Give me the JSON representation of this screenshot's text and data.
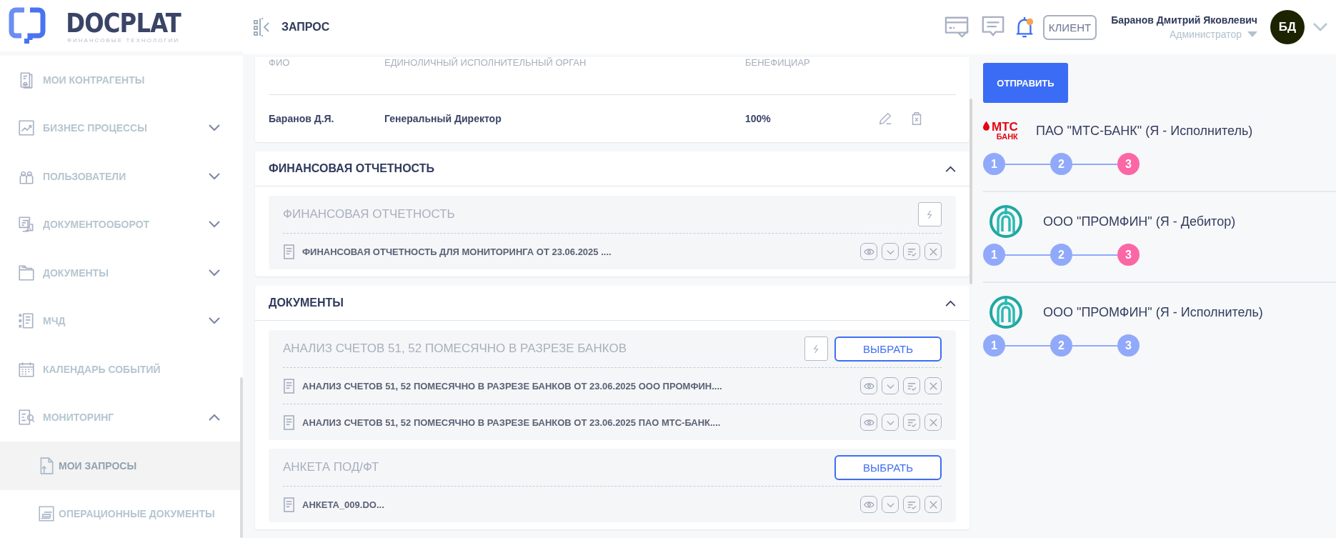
{
  "logo": {
    "name": "DOCPLAT",
    "tagline": "ФИНАНСОВЫЕ ТЕХНОЛОГИИ"
  },
  "sidebar": {
    "items": [
      {
        "label": "МОИ КОНТРАГЕНТЫ",
        "kind": "link",
        "selected": false
      },
      {
        "label": "БИЗНЕС ПРОЦЕССЫ",
        "kind": "group",
        "expanded": false,
        "selected": false
      },
      {
        "label": "ПОЛЬЗОВАТЕЛИ",
        "kind": "group",
        "expanded": false,
        "selected": false
      },
      {
        "label": "ДОКУМЕНТООБОРОТ",
        "kind": "group",
        "expanded": false,
        "selected": false
      },
      {
        "label": "ДОКУМЕНТЫ",
        "kind": "group",
        "expanded": false,
        "selected": false
      },
      {
        "label": "МЧД",
        "kind": "group",
        "expanded": false,
        "selected": false
      },
      {
        "label": "КАЛЕНДАРЬ СОБЫТИЙ",
        "kind": "link",
        "selected": false
      },
      {
        "label": "МОНИТОРИНГ",
        "kind": "group",
        "expanded": true,
        "selected": false,
        "children": [
          {
            "label": "МОИ ЗАПРОСЫ",
            "selected": true
          },
          {
            "label": "ОПЕРАЦИОННЫЕ ДОКУМЕНТЫ",
            "selected": false
          }
        ]
      }
    ]
  },
  "header": {
    "title": "ЗАПРОС",
    "notifications_unread": true,
    "role_button": "КЛИЕНТ",
    "user_name": "Баранов Дмитрий Яковлевич",
    "user_role": "Администратор",
    "avatar_initials": "БД"
  },
  "table": {
    "columns": [
      "ФИО",
      "ЕДИНОЛИЧНЫЙ ИСПОЛНИТЕЛЬНЫЙ ОРГАН",
      "БЕНЕФИЦИАР"
    ],
    "rows": [
      [
        "Баранов Д.Я.",
        "Генеральный Директор",
        "100%"
      ]
    ]
  },
  "sections": [
    {
      "title": "ФИНАНСОВАЯ ОТЧЕТНОСТЬ",
      "expanded": true,
      "groups": [
        {
          "title": "ФИНАНСОВАЯ ОТЧЕТНОСТЬ",
          "auto_button": true,
          "files": [
            "ФИНАНСОВАЯ ОТЧЕТНОСТЬ ДЛЯ МОНИТОРИНГА ОТ 23.06.2025 ...."
          ]
        }
      ]
    },
    {
      "title": "ДОКУМЕНТЫ",
      "expanded": true,
      "groups": [
        {
          "title": "АНАЛИЗ СЧЕТОВ 51, 52 ПОМЕСЯЧНО В РАЗРЕЗЕ БАНКОВ",
          "auto_button": true,
          "select_button": "ВЫБРАТЬ",
          "files": [
            "АНАЛИЗ СЧЕТОВ 51, 52 ПОМЕСЯЧНО В РАЗРЕЗЕ БАНКОВ ОТ 23.06.2025 ООО ПРОМФИН....",
            "АНАЛИЗ СЧЕТОВ 51, 52 ПОМЕСЯЧНО В РАЗРЕЗЕ БАНКОВ ОТ 23.06.2025 ПАО МТС-БАНК...."
          ]
        },
        {
          "title": "АНКЕТА ПОД/ФТ",
          "auto_button": false,
          "select_button": "ВЫБРАТЬ",
          "files": [
            "АНКЕТА_009.DO..."
          ]
        }
      ]
    }
  ],
  "side_panel": {
    "send_button": "ОТПРАВИТЬ",
    "participants": [
      {
        "kind": "mts",
        "logo_text": [
          "МТС",
          "БАНК"
        ],
        "name": "ПАО \"МТС-БАНК\" (Я - Исполнитель)",
        "steps": [
          {
            "label": "1",
            "color": "#91a9fa"
          },
          {
            "label": "2",
            "color": "#91a9fa"
          },
          {
            "label": "3",
            "color": "#fb67a5"
          }
        ]
      },
      {
        "kind": "promfin",
        "name": "ООО \"ПРОМФИН\" (Я - Дебитор)",
        "steps": [
          {
            "label": "1",
            "color": "#91a9fa"
          },
          {
            "label": "2",
            "color": "#91a9fa"
          },
          {
            "label": "3",
            "color": "#fb67a5"
          }
        ]
      },
      {
        "kind": "promfin",
        "name": "ООО \"ПРОМФИН\" (Я - Исполнитель)",
        "steps": [
          {
            "label": "1",
            "color": "#91a9fa"
          },
          {
            "label": "2",
            "color": "#91a9fa"
          },
          {
            "label": "3",
            "color": "#91a9fa"
          }
        ]
      }
    ]
  }
}
